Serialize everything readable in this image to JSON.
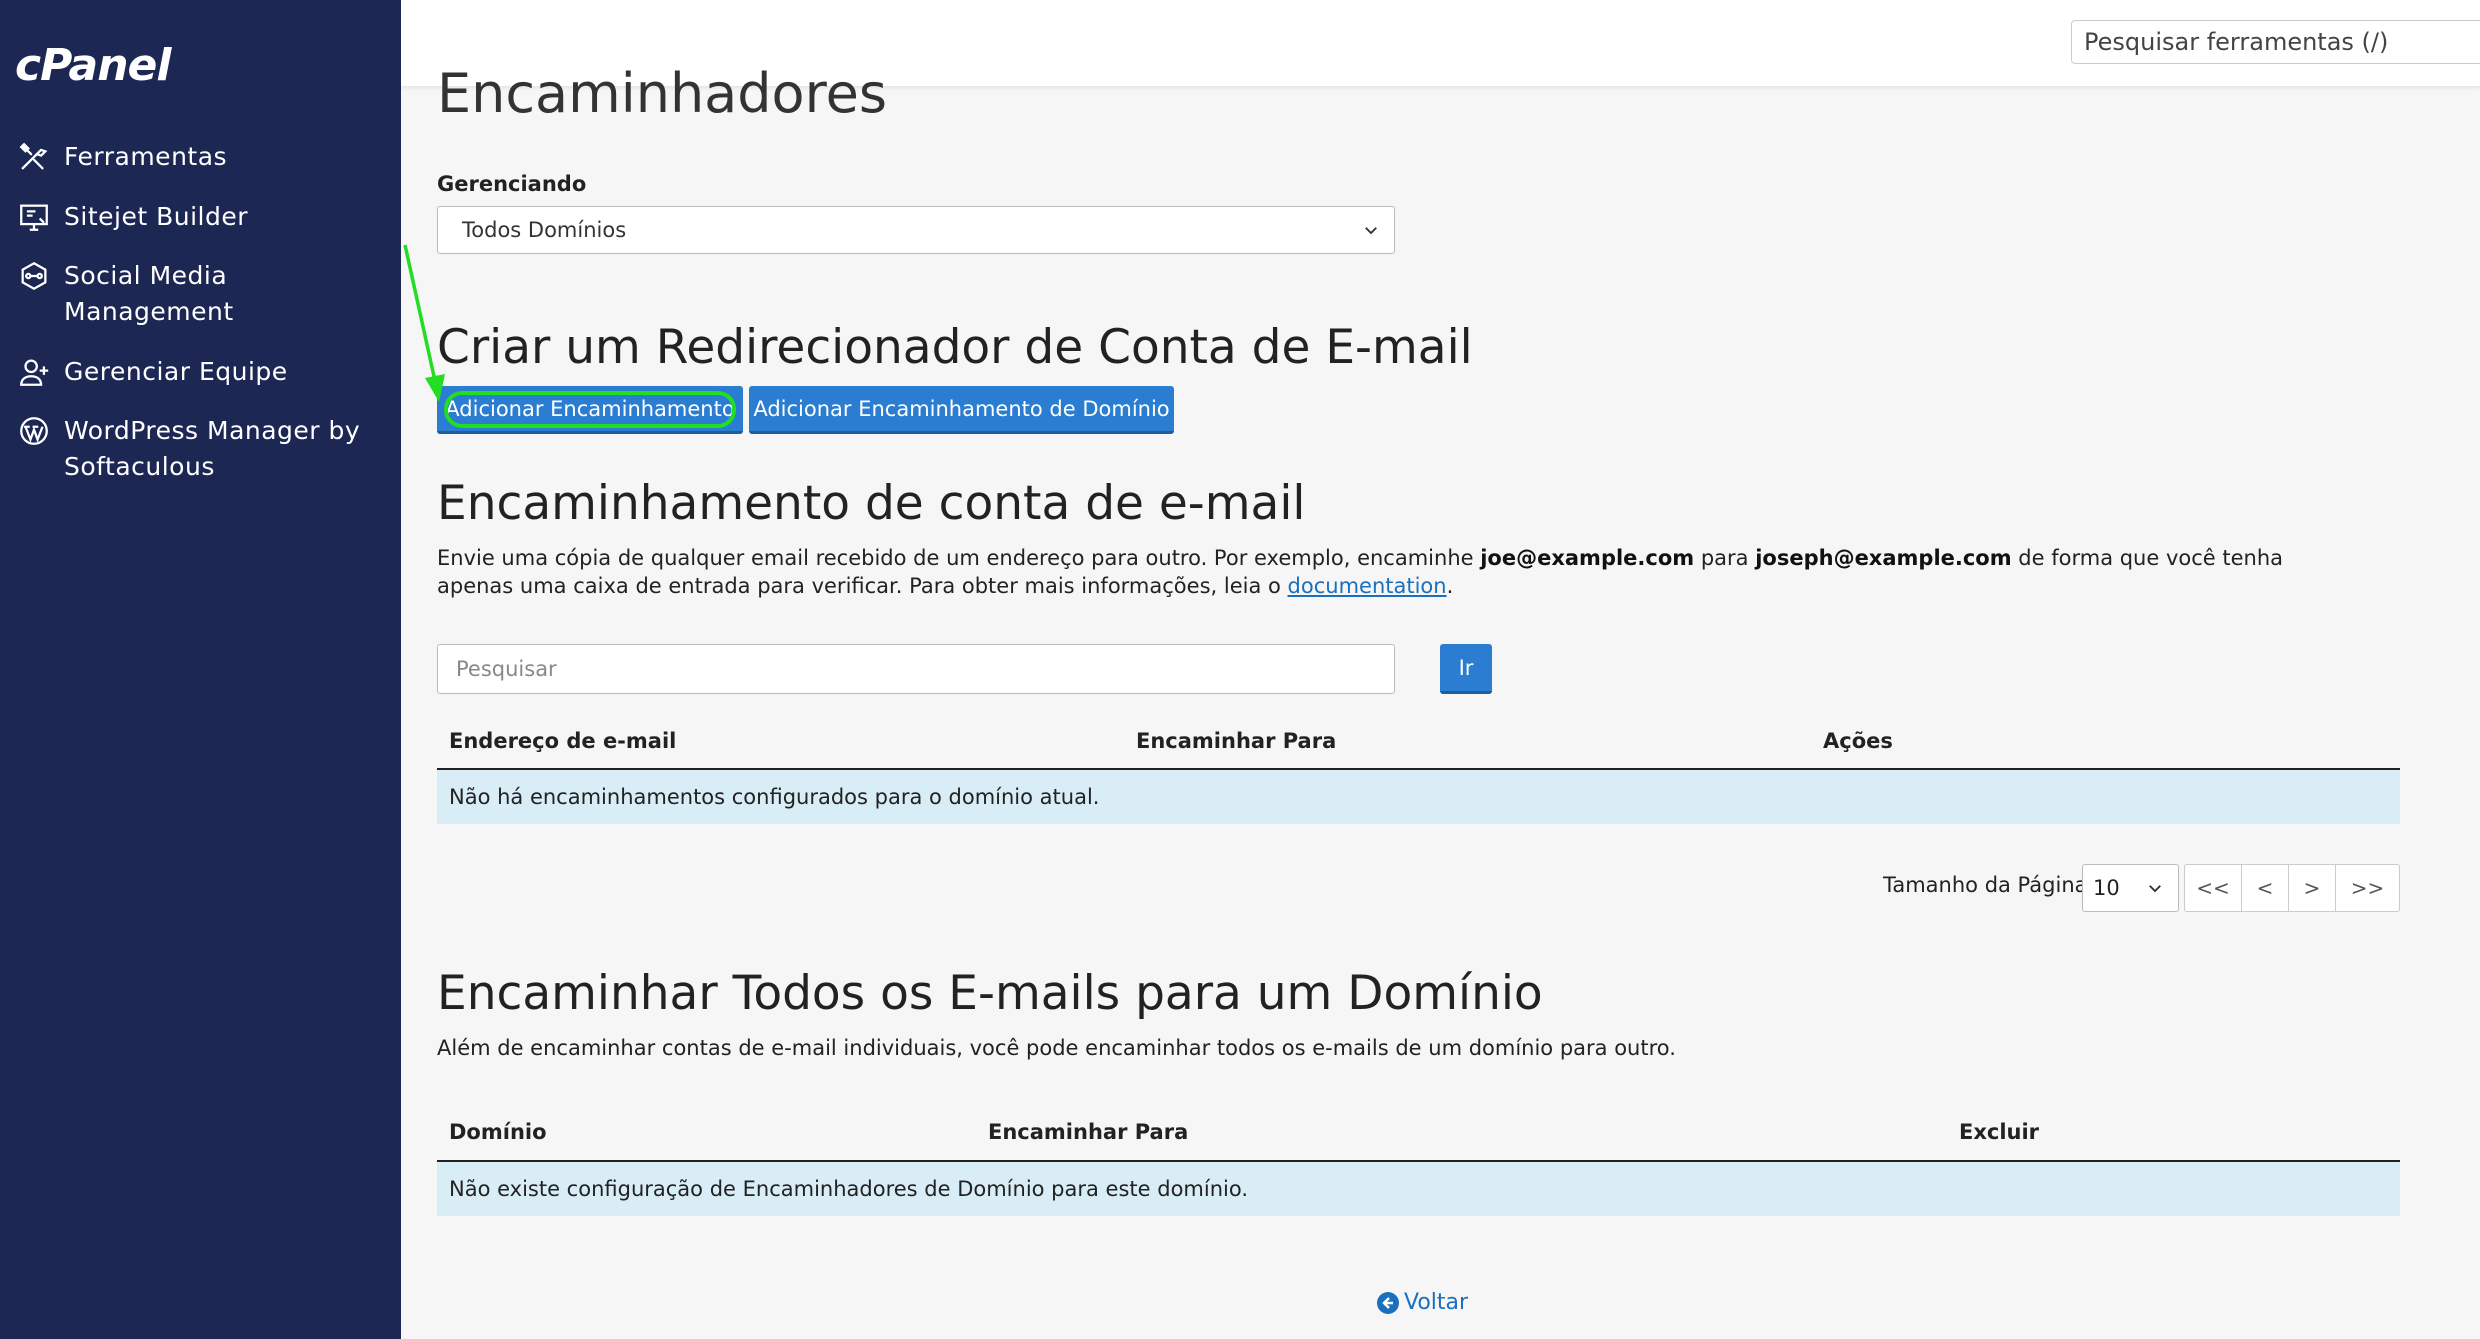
{
  "brand": "cPanel",
  "top_search": {
    "placeholder": "Pesquisar ferramentas (/)"
  },
  "sidebar": {
    "items": [
      {
        "label": "Ferramentas",
        "icon": "tools-icon"
      },
      {
        "label": "Sitejet Builder",
        "icon": "monitor-icon"
      },
      {
        "label": "Social Media\nManagement",
        "icon": "social-icon"
      },
      {
        "label": "Gerenciar Equipe",
        "icon": "user-plus-icon"
      },
      {
        "label": "WordPress Manager by\nSoftaculous",
        "icon": "wordpress-icon"
      }
    ]
  },
  "page": {
    "title": "Encaminhadores",
    "managing_label": "Gerenciando",
    "managing_value": "Todos Domínios",
    "create_section_title": "Criar um Redirecionador de Conta de E-mail",
    "add_forwarder_label": "Adicionar Encaminhamento",
    "add_domain_forwarder_label": "Adicionar Encaminhamento de Domínio",
    "account_section_title": "Encaminhamento de conta de e-mail",
    "account_desc_1": "Envie uma cópia de qualquer email recebido de um endereço para outro. Por exemplo, encaminhe ",
    "account_desc_email1": "joe@example.com",
    "account_desc_2": " para ",
    "account_desc_email2": "joseph@example.com",
    "account_desc_3": " de forma que você tenha apenas uma caixa de entrada para verificar. Para obter mais informações, leia o ",
    "account_desc_link": "documentation",
    "account_desc_4": ".",
    "search_placeholder": "Pesquisar",
    "go_label": "Ir",
    "account_table": {
      "headers": [
        "Endereço de e-mail",
        "Encaminhar Para",
        "Ações"
      ],
      "empty_message": "Não há encaminhamentos configurados para o domínio atual."
    },
    "pager": {
      "page_size_label": "Tamanho da Página",
      "page_size_value": "10",
      "first": "<<",
      "prev": "<",
      "next": ">",
      "last": ">>"
    },
    "domain_section_title": "Encaminhar Todos os E-mails para um Domínio",
    "domain_desc": "Além de encaminhar contas de e-mail individuais, você pode encaminhar todos os e-mails de um domínio para outro.",
    "domain_table": {
      "headers": [
        "Domínio",
        "Encaminhar Para",
        "Excluir"
      ],
      "empty_message": "Não existe configuração de Encaminhadores de Domínio para este domínio."
    },
    "back_label": "Voltar"
  },
  "colors": {
    "sidebar_bg": "#1c2754",
    "primary_button": "#2b7dd1",
    "empty_row_bg": "#d9edf7",
    "highlight": "#22dd22"
  }
}
